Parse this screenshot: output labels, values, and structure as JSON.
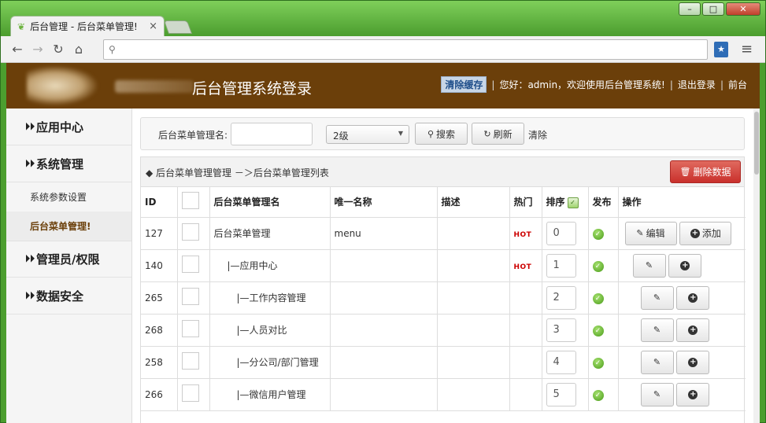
{
  "browser": {
    "tab_title": "后台管理 - 后台菜单管理!",
    "tab_close": "×",
    "address": "",
    "win_minimize": "–",
    "win_maximize": "□",
    "win_close": "✕",
    "icons": {
      "back": "back-arrow-icon",
      "forward": "forward-arrow-icon",
      "reload": "reload-icon",
      "home": "home-icon",
      "search": "search-icon",
      "bookmark": "bookmark-icon",
      "menu": "hamburger-menu-icon"
    }
  },
  "header": {
    "title": "后台管理系统登录",
    "clear_cache": "清除缓存",
    "greeting": "您好：admin，欢迎使用后台管理系统!",
    "logout": "退出登录",
    "frontend": "前台",
    "separator": "|",
    "brand_color": "#6b3f0a"
  },
  "sidebar": {
    "groups": [
      {
        "label": "应用中心"
      },
      {
        "label": "系统管理"
      },
      {
        "label": "管理员/权限"
      },
      {
        "label": "数据安全"
      }
    ],
    "sub_items": [
      {
        "label": "系统参数设置"
      },
      {
        "label": "后台菜单管理!"
      }
    ]
  },
  "search": {
    "label": "后台菜单管理名:",
    "input_value": "",
    "level_selected": "2级",
    "search_btn": "搜索",
    "refresh_btn": "刷新",
    "clear": "清除"
  },
  "list": {
    "breadcrumb": "◆ 后台菜单管理管理 －＞后台菜单管理列表",
    "delete_btn": "删除数据",
    "columns": [
      "ID",
      "",
      "后台菜单管理名",
      "唯一名称",
      "描述",
      "热门",
      "排序",
      "发布",
      "操作"
    ],
    "edit_label": "编辑",
    "add_label": "添加",
    "rows": [
      {
        "id": "127",
        "name": "后台菜单管理",
        "unique": "menu",
        "desc": "",
        "hot": "HOT",
        "sort": "0",
        "indent": 0
      },
      {
        "id": "140",
        "name": "|—应用中心",
        "unique": "",
        "desc": "",
        "hot": "HOT",
        "sort": "1",
        "indent": 1
      },
      {
        "id": "265",
        "name": "|—工作内容管理",
        "unique": "",
        "desc": "",
        "hot": "",
        "sort": "2",
        "indent": 2
      },
      {
        "id": "268",
        "name": "|—人员对比",
        "unique": "",
        "desc": "",
        "hot": "",
        "sort": "3",
        "indent": 2
      },
      {
        "id": "258",
        "name": "|—分公司/部门管理",
        "unique": "",
        "desc": "",
        "hot": "",
        "sort": "4",
        "indent": 2
      },
      {
        "id": "266",
        "name": "|—微信用户管理",
        "unique": "",
        "desc": "",
        "hot": "",
        "sort": "5",
        "indent": 2
      }
    ]
  }
}
